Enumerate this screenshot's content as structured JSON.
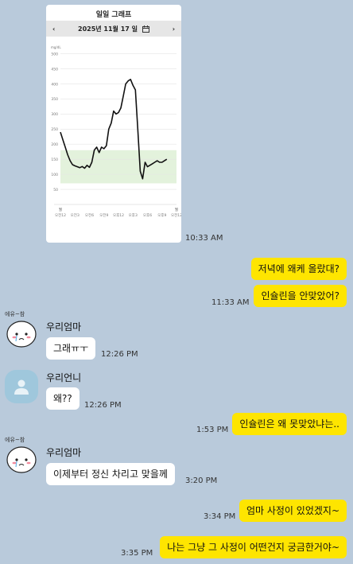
{
  "image_card": {
    "title": "일일 그래프",
    "date": "2025년 11월 17 일",
    "prev_arrow": "‹",
    "next_arrow": "›",
    "time": "10:33 AM"
  },
  "chart_data": {
    "type": "line",
    "ylabel": "mg/dL",
    "yticks": [
      500,
      450,
      400,
      350,
      300,
      250,
      200,
      150,
      100,
      50
    ],
    "xticks": [
      "오전12",
      "오전3",
      "오전6",
      "오전9",
      "오후12",
      "오후3",
      "오후6",
      "오후9",
      "오전12"
    ],
    "day_labels": [
      "월",
      "월"
    ],
    "ylim": [
      0,
      520
    ],
    "target_range": [
      70,
      180
    ],
    "series": [
      {
        "x": [
          0,
          0.5,
          1,
          1.5,
          2,
          2.5,
          3,
          3.5,
          4,
          4.5,
          5,
          5.5,
          6,
          6.5,
          7,
          7.5,
          8,
          8.5,
          9,
          9.5,
          10,
          10.5,
          11,
          11.5,
          12,
          12.5,
          13,
          13.5,
          14,
          14.5,
          15,
          15.5,
          16,
          16.5,
          17,
          17.5,
          18,
          18.5,
          19,
          19.5,
          20,
          20.5,
          21,
          21.5,
          22
        ],
        "y": [
          240,
          215,
          190,
          165,
          145,
          132,
          128,
          125,
          122,
          126,
          120,
          130,
          123,
          140,
          180,
          190,
          172,
          190,
          185,
          195,
          250,
          270,
          310,
          300,
          305,
          320,
          360,
          400,
          410,
          415,
          395,
          380,
          250,
          110,
          85,
          140,
          125,
          130,
          135,
          140,
          145,
          140,
          140,
          145,
          150
        ]
      }
    ]
  },
  "messages": [
    {
      "text": "저녁에 왜케 올랐대?"
    },
    {
      "text": "인슐린을 안맞았어?",
      "time": "11:33 AM"
    },
    {
      "sender": "우리엄마",
      "avatar_caption": "에유~참",
      "text": "그래ㅠㅜ",
      "time": "12:26 PM"
    },
    {
      "sender": "우리언니",
      "text": "왜??",
      "time": "12:26 PM"
    },
    {
      "text": "인슐린은 왜 못맞았냐는..",
      "time": "1:53 PM"
    },
    {
      "sender": "우리엄마",
      "avatar_caption": "에유~참",
      "text": "이제부터 정신 차리고 맞을께",
      "time": "3:20 PM"
    },
    {
      "text": "엄마 사정이 있었겠지~",
      "time": "3:34 PM"
    },
    {
      "text": "나는 그냥 그 사정이 어떤건지 궁금한거야~",
      "time": "3:35 PM"
    }
  ]
}
